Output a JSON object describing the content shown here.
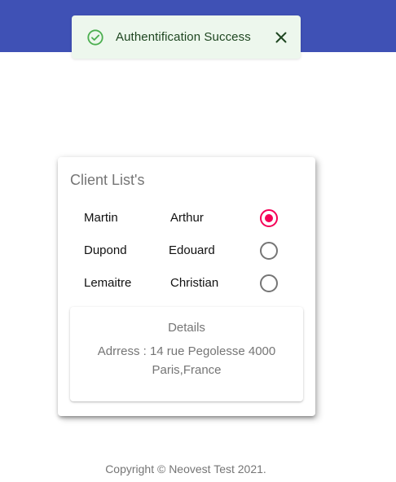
{
  "app": {
    "accent_color": "#3f51b5",
    "radio_accent": "#f50057"
  },
  "toast": {
    "message": "Authentification Success",
    "status": "success",
    "icon": "check-circle-icon",
    "close_icon": "close-icon"
  },
  "card": {
    "title": "Client List's",
    "clients": [
      {
        "last_name": "Martin",
        "first_name": "Arthur",
        "selected": true
      },
      {
        "last_name": "Dupond",
        "first_name": "Edouard",
        "selected": false
      },
      {
        "last_name": "Lemaitre",
        "first_name": "Christian",
        "selected": false
      }
    ],
    "details": {
      "title": "Details",
      "address_line1": "Adrress : 14 rue Pegolesse 4000",
      "address_line2": "Paris,France"
    }
  },
  "footer": {
    "copyright": "Copyright © Neovest Test 2021."
  }
}
